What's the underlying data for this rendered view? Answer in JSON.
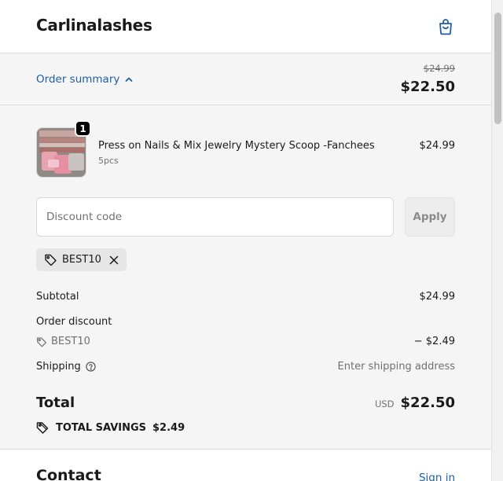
{
  "header": {
    "brand": "Carlinalashes",
    "cart_icon": "shopping-bag-icon"
  },
  "summary": {
    "toggle_label": "Order summary",
    "original_price": "$24.99",
    "current_price": "$22.50"
  },
  "product": {
    "quantity": "1",
    "name": "Press on Nails & Mix Jewelry Mystery Scoop -Fanchees",
    "variant": "5pcs",
    "price": "$24.99"
  },
  "discount": {
    "placeholder": "Discount code",
    "apply_label": "Apply",
    "applied_code": "BEST10"
  },
  "totals": {
    "subtotal_label": "Subtotal",
    "subtotal_value": "$24.99",
    "order_discount_label": "Order discount",
    "discount_code": "BEST10",
    "discount_value": "− $2.49",
    "shipping_label": "Shipping",
    "shipping_value": "Enter shipping address",
    "total_label": "Total",
    "currency": "USD",
    "total_value": "$22.50",
    "savings_label": "TOTAL SAVINGS",
    "savings_value": "$2.49"
  },
  "contact": {
    "title": "Contact",
    "sign_in": "Sign in"
  },
  "colors": {
    "link": "#1f5fa8",
    "panel_bg": "#f5f5f5"
  }
}
